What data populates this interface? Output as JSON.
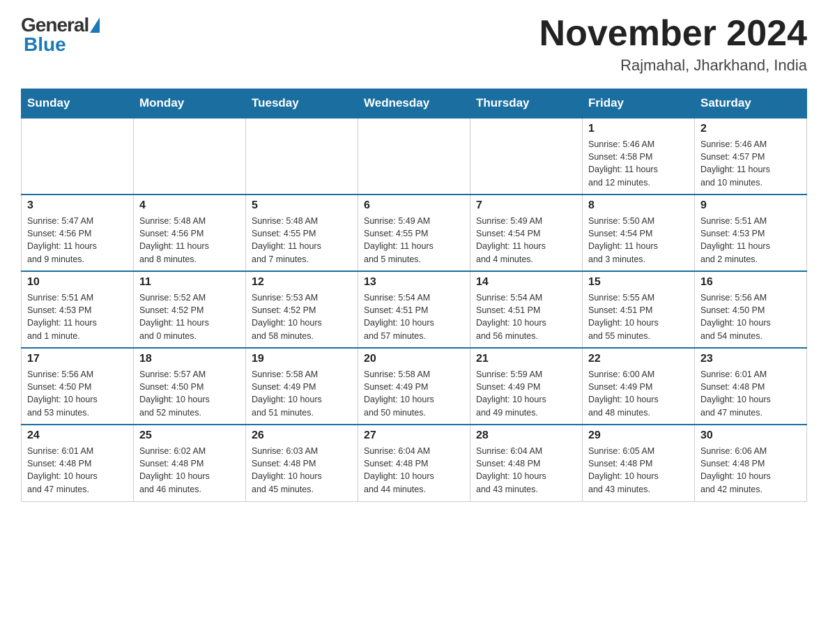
{
  "logo": {
    "general": "General",
    "blue": "Blue"
  },
  "header": {
    "month_year": "November 2024",
    "location": "Rajmahal, Jharkhand, India"
  },
  "weekdays": [
    "Sunday",
    "Monday",
    "Tuesday",
    "Wednesday",
    "Thursday",
    "Friday",
    "Saturday"
  ],
  "weeks": [
    [
      {
        "day": "",
        "info": ""
      },
      {
        "day": "",
        "info": ""
      },
      {
        "day": "",
        "info": ""
      },
      {
        "day": "",
        "info": ""
      },
      {
        "day": "",
        "info": ""
      },
      {
        "day": "1",
        "info": "Sunrise: 5:46 AM\nSunset: 4:58 PM\nDaylight: 11 hours\nand 12 minutes."
      },
      {
        "day": "2",
        "info": "Sunrise: 5:46 AM\nSunset: 4:57 PM\nDaylight: 11 hours\nand 10 minutes."
      }
    ],
    [
      {
        "day": "3",
        "info": "Sunrise: 5:47 AM\nSunset: 4:56 PM\nDaylight: 11 hours\nand 9 minutes."
      },
      {
        "day": "4",
        "info": "Sunrise: 5:48 AM\nSunset: 4:56 PM\nDaylight: 11 hours\nand 8 minutes."
      },
      {
        "day": "5",
        "info": "Sunrise: 5:48 AM\nSunset: 4:55 PM\nDaylight: 11 hours\nand 7 minutes."
      },
      {
        "day": "6",
        "info": "Sunrise: 5:49 AM\nSunset: 4:55 PM\nDaylight: 11 hours\nand 5 minutes."
      },
      {
        "day": "7",
        "info": "Sunrise: 5:49 AM\nSunset: 4:54 PM\nDaylight: 11 hours\nand 4 minutes."
      },
      {
        "day": "8",
        "info": "Sunrise: 5:50 AM\nSunset: 4:54 PM\nDaylight: 11 hours\nand 3 minutes."
      },
      {
        "day": "9",
        "info": "Sunrise: 5:51 AM\nSunset: 4:53 PM\nDaylight: 11 hours\nand 2 minutes."
      }
    ],
    [
      {
        "day": "10",
        "info": "Sunrise: 5:51 AM\nSunset: 4:53 PM\nDaylight: 11 hours\nand 1 minute."
      },
      {
        "day": "11",
        "info": "Sunrise: 5:52 AM\nSunset: 4:52 PM\nDaylight: 11 hours\nand 0 minutes."
      },
      {
        "day": "12",
        "info": "Sunrise: 5:53 AM\nSunset: 4:52 PM\nDaylight: 10 hours\nand 58 minutes."
      },
      {
        "day": "13",
        "info": "Sunrise: 5:54 AM\nSunset: 4:51 PM\nDaylight: 10 hours\nand 57 minutes."
      },
      {
        "day": "14",
        "info": "Sunrise: 5:54 AM\nSunset: 4:51 PM\nDaylight: 10 hours\nand 56 minutes."
      },
      {
        "day": "15",
        "info": "Sunrise: 5:55 AM\nSunset: 4:51 PM\nDaylight: 10 hours\nand 55 minutes."
      },
      {
        "day": "16",
        "info": "Sunrise: 5:56 AM\nSunset: 4:50 PM\nDaylight: 10 hours\nand 54 minutes."
      }
    ],
    [
      {
        "day": "17",
        "info": "Sunrise: 5:56 AM\nSunset: 4:50 PM\nDaylight: 10 hours\nand 53 minutes."
      },
      {
        "day": "18",
        "info": "Sunrise: 5:57 AM\nSunset: 4:50 PM\nDaylight: 10 hours\nand 52 minutes."
      },
      {
        "day": "19",
        "info": "Sunrise: 5:58 AM\nSunset: 4:49 PM\nDaylight: 10 hours\nand 51 minutes."
      },
      {
        "day": "20",
        "info": "Sunrise: 5:58 AM\nSunset: 4:49 PM\nDaylight: 10 hours\nand 50 minutes."
      },
      {
        "day": "21",
        "info": "Sunrise: 5:59 AM\nSunset: 4:49 PM\nDaylight: 10 hours\nand 49 minutes."
      },
      {
        "day": "22",
        "info": "Sunrise: 6:00 AM\nSunset: 4:49 PM\nDaylight: 10 hours\nand 48 minutes."
      },
      {
        "day": "23",
        "info": "Sunrise: 6:01 AM\nSunset: 4:48 PM\nDaylight: 10 hours\nand 47 minutes."
      }
    ],
    [
      {
        "day": "24",
        "info": "Sunrise: 6:01 AM\nSunset: 4:48 PM\nDaylight: 10 hours\nand 47 minutes."
      },
      {
        "day": "25",
        "info": "Sunrise: 6:02 AM\nSunset: 4:48 PM\nDaylight: 10 hours\nand 46 minutes."
      },
      {
        "day": "26",
        "info": "Sunrise: 6:03 AM\nSunset: 4:48 PM\nDaylight: 10 hours\nand 45 minutes."
      },
      {
        "day": "27",
        "info": "Sunrise: 6:04 AM\nSunset: 4:48 PM\nDaylight: 10 hours\nand 44 minutes."
      },
      {
        "day": "28",
        "info": "Sunrise: 6:04 AM\nSunset: 4:48 PM\nDaylight: 10 hours\nand 43 minutes."
      },
      {
        "day": "29",
        "info": "Sunrise: 6:05 AM\nSunset: 4:48 PM\nDaylight: 10 hours\nand 43 minutes."
      },
      {
        "day": "30",
        "info": "Sunrise: 6:06 AM\nSunset: 4:48 PM\nDaylight: 10 hours\nand 42 minutes."
      }
    ]
  ]
}
